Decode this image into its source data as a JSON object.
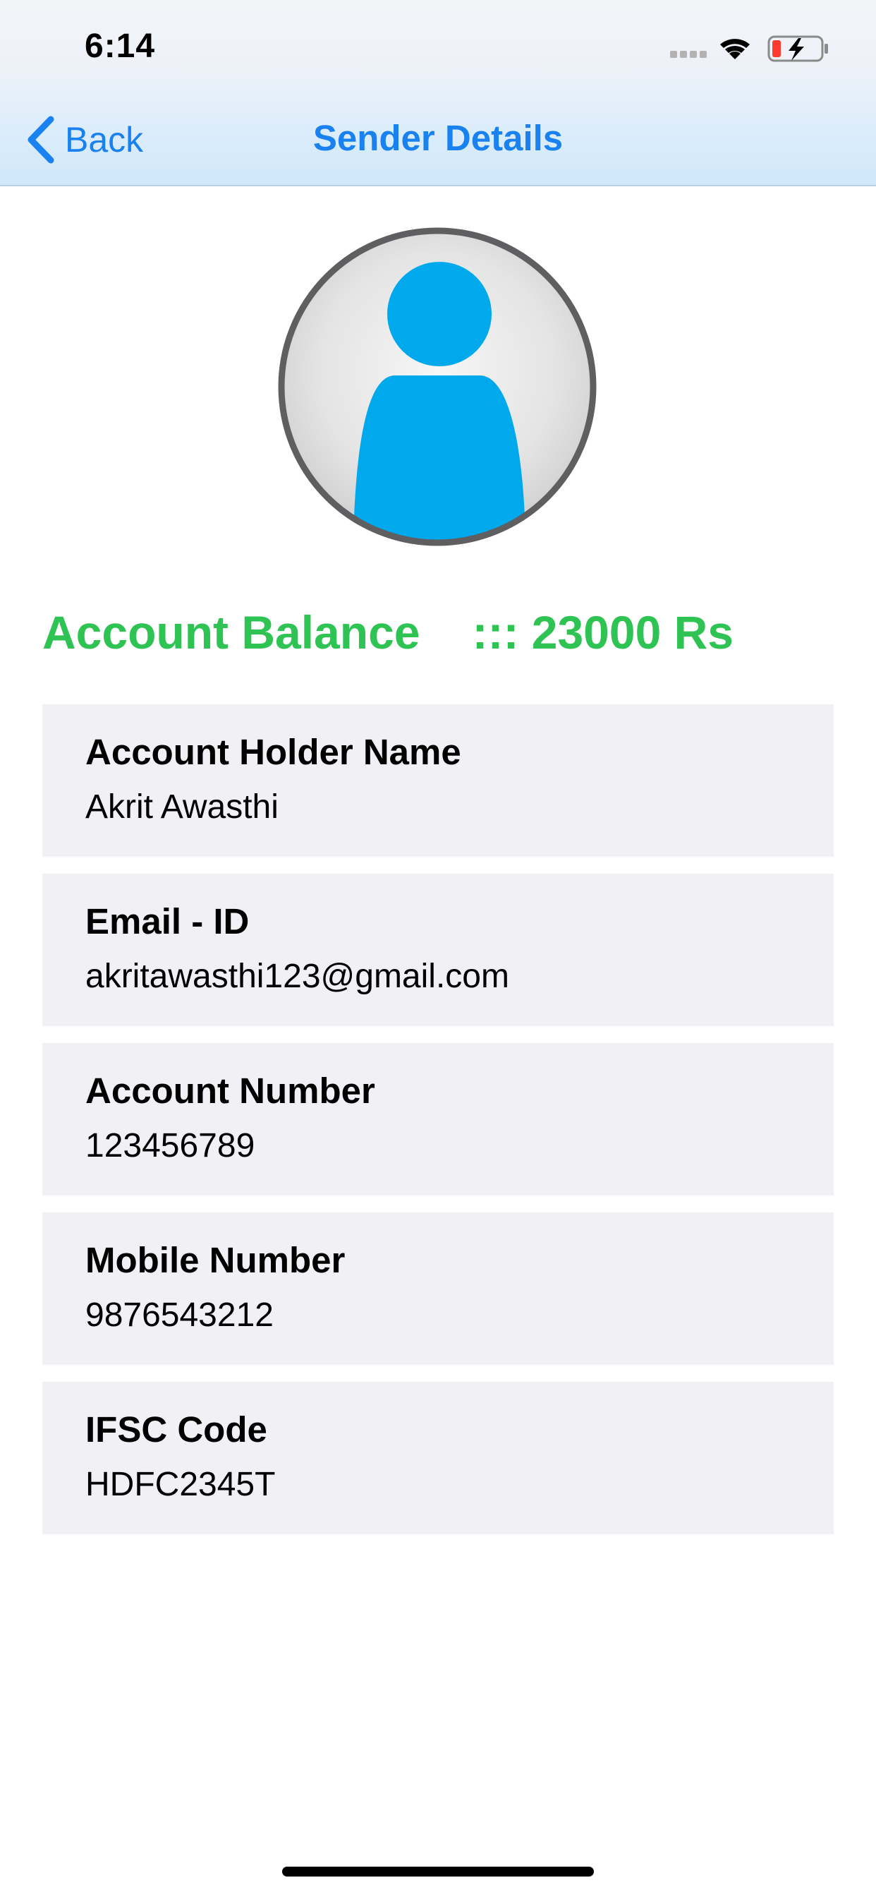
{
  "status_bar": {
    "time": "6:14",
    "icons": [
      "signal-dots-icon",
      "wifi-icon",
      "battery-charging-icon"
    ]
  },
  "nav": {
    "back_label": "Back",
    "title": "Sender Details"
  },
  "colors": {
    "accent_blue": "#1a82f0",
    "balance_green": "#2fc354",
    "avatar_blue": "#00a9ec",
    "card_background": "#f1f1f5"
  },
  "balance": {
    "label": "Account Balance",
    "value": "::: 23000 Rs"
  },
  "details": [
    {
      "label": "Account Holder Name",
      "value": "Akrit Awasthi"
    },
    {
      "label": "Email - ID",
      "value": "akritawasthi123@gmail.com"
    },
    {
      "label": "Account Number",
      "value": "123456789"
    },
    {
      "label": "Mobile Number",
      "value": "9876543212"
    },
    {
      "label": "IFSC Code",
      "value": "HDFC2345T"
    }
  ]
}
